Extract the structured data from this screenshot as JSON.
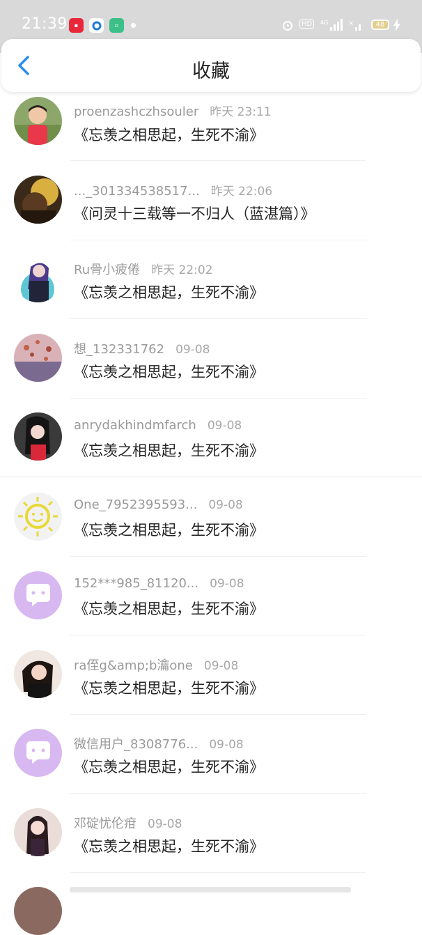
{
  "status_bar": {
    "time": "21:39",
    "battery": "48",
    "indicators": [
      "alarm-icon",
      "hd-icon",
      "4g-signal-icon",
      "wifi-off-icon",
      "charging-icon"
    ]
  },
  "header": {
    "back_icon": "chevron-left-icon",
    "title": "收藏"
  },
  "favorites": [
    {
      "user": "proenzashczhsouler",
      "date": "昨天 23:11",
      "title": "《忘羡之相思起，生死不渝》"
    },
    {
      "user": "..._301334538517...",
      "date": "昨天 22:06",
      "title": "《问灵十三载等一不归人（蓝湛篇）》"
    },
    {
      "user": "Ru骨小疲倦",
      "date": "昨天 22:02",
      "title": "《忘羡之相思起，生死不渝》"
    },
    {
      "user": "想_132331762",
      "date": "09-08",
      "title": "《忘羡之相思起，生死不渝》"
    },
    {
      "user": "anrydakhindmfarch",
      "date": "09-08",
      "title": "《忘羡之相思起，生死不渝》"
    },
    {
      "user": "One_7952395593...",
      "date": "09-08",
      "title": "《忘羡之相思起，生死不渝》"
    },
    {
      "user": "152***985_81120...",
      "date": "09-08",
      "title": "《忘羡之相思起，生死不渝》"
    },
    {
      "user": "ra侄g&amp;b瀹one",
      "date": "09-08",
      "title": "《忘羡之相思起，生死不渝》"
    },
    {
      "user": "微信用户_8308776...",
      "date": "09-08",
      "title": "《忘羡之相思起，生死不渝》"
    },
    {
      "user": "邓碇忧伦疳",
      "date": "09-08",
      "title": "《忘羡之相思起，生死不渝》"
    }
  ],
  "colors": {
    "accent": "#2a8cf0",
    "status_bar": "#d9d9d9",
    "default_avatar": "#d8b8f0"
  }
}
